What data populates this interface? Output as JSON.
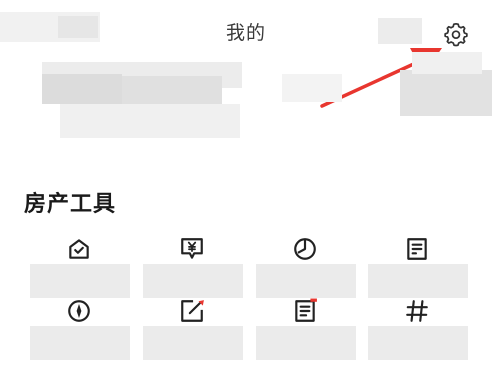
{
  "header": {
    "title": "我的",
    "settings_icon": "gear-icon"
  },
  "annotation": {
    "color": "#e8362f",
    "icon": "arrow-icon"
  },
  "tools_section": {
    "title": "房产工具",
    "items": [
      {
        "icon": "house-check-icon",
        "label": ""
      },
      {
        "icon": "yen-message-icon",
        "label": ""
      },
      {
        "icon": "pie-chart-icon",
        "label": ""
      },
      {
        "icon": "document-list-icon",
        "label": ""
      },
      {
        "icon": "compass-icon",
        "label": ""
      },
      {
        "icon": "edit-note-icon",
        "label": ""
      },
      {
        "icon": "list-doc-icon",
        "label": ""
      },
      {
        "icon": "hash-icon",
        "label": ""
      }
    ]
  }
}
